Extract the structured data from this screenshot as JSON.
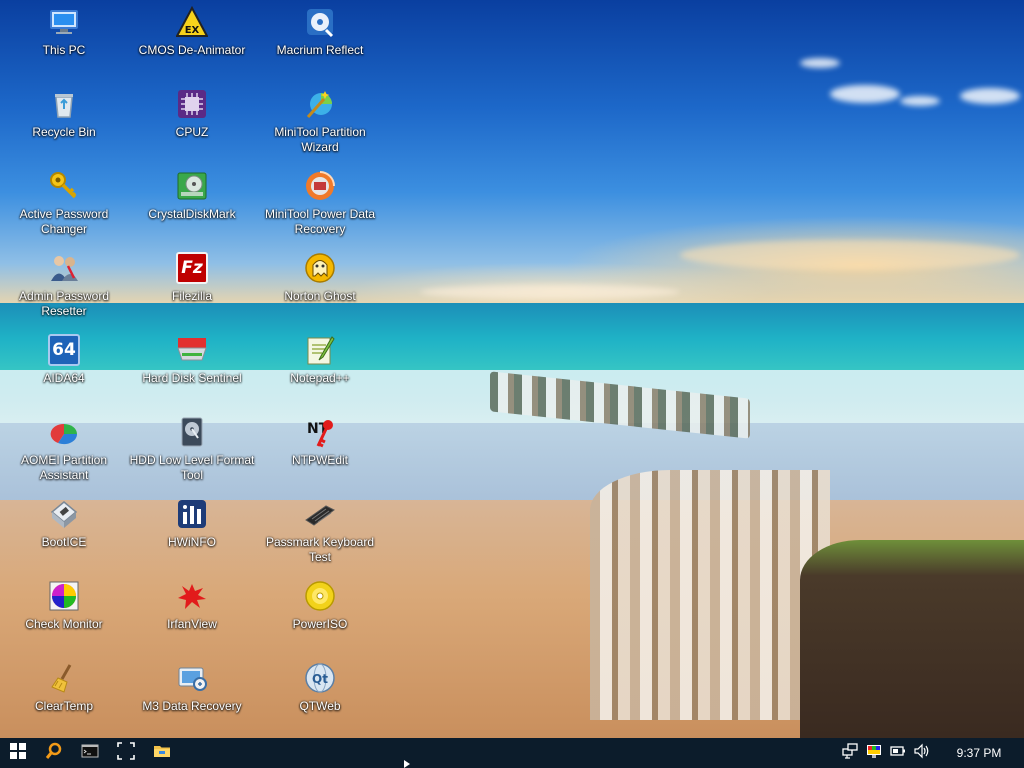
{
  "desktop": {
    "icons": [
      {
        "label": "This PC",
        "icon": "computer-icon"
      },
      {
        "label": "Recycle Bin",
        "icon": "recycle-bin-icon"
      },
      {
        "label": "Active Password Changer",
        "icon": "key-icon"
      },
      {
        "label": "Admin Password Resetter",
        "icon": "admin-users-icon"
      },
      {
        "label": "AIDA64",
        "icon": "aida64-icon",
        "glyph": "64"
      },
      {
        "label": "AOMEI Partition Assistant",
        "icon": "aomei-disk-icon"
      },
      {
        "label": "BootICE",
        "icon": "bootice-drive-icon"
      },
      {
        "label": "Check Monitor",
        "icon": "color-monitor-icon"
      },
      {
        "label": "ClearTemp",
        "icon": "broom-icon"
      },
      {
        "label": "CMOS De-Animator",
        "icon": "warning-ex-icon",
        "glyph": "EX"
      },
      {
        "label": "CPUZ",
        "icon": "cpu-chip-icon"
      },
      {
        "label": "CrystalDiskMark",
        "icon": "disk-benchmark-icon"
      },
      {
        "label": "Filezilla",
        "icon": "filezilla-icon",
        "glyph": "Fz"
      },
      {
        "label": "Hard Disk Sentinel",
        "icon": "hard-disk-icon"
      },
      {
        "label": "HDD Low Level Format Tool",
        "icon": "hdd-format-icon"
      },
      {
        "label": "HWiNFO",
        "icon": "hwinfo-bars-icon"
      },
      {
        "label": "IrfanView",
        "icon": "irfanview-splat-icon"
      },
      {
        "label": "M3 Data Recovery",
        "icon": "m3-recovery-icon"
      },
      {
        "label": "Macrium Reflect",
        "icon": "macrium-icon"
      },
      {
        "label": "MiniTool Partition Wizard",
        "icon": "magic-wand-icon"
      },
      {
        "label": "MiniTool Power Data Recovery",
        "icon": "data-recovery-icon"
      },
      {
        "label": "Norton Ghost",
        "icon": "ghost-icon"
      },
      {
        "label": "Notepad++",
        "icon": "notepad-icon"
      },
      {
        "label": "NTPWEdit",
        "icon": "ntpwedit-icon",
        "glyph": "NT"
      },
      {
        "label": "Passmark Keyboard Test",
        "icon": "keyboard-icon"
      },
      {
        "label": "PowerISO",
        "icon": "disc-icon"
      },
      {
        "label": "QTWeb",
        "icon": "qtweb-globe-icon",
        "glyph": "Qt"
      }
    ]
  },
  "taskbar": {
    "buttons": [
      {
        "name": "start-button",
        "icon": "windows-logo-icon"
      },
      {
        "name": "search-button",
        "icon": "search-icon"
      },
      {
        "name": "command-prompt-button",
        "icon": "cmd-icon"
      },
      {
        "name": "screenshot-button",
        "icon": "capture-frame-icon"
      },
      {
        "name": "file-explorer-button",
        "icon": "folder-icon"
      }
    ],
    "tray": [
      {
        "name": "network-tray",
        "icon": "network-icon"
      },
      {
        "name": "display-tray",
        "icon": "color-display-icon"
      },
      {
        "name": "battery-tray",
        "icon": "battery-icon"
      },
      {
        "name": "volume-tray",
        "icon": "volume-icon"
      }
    ],
    "clock": "9:37 PM"
  },
  "colors": {
    "taskbar_bg": "#0c1c2b",
    "label_text": "#ffffff"
  }
}
